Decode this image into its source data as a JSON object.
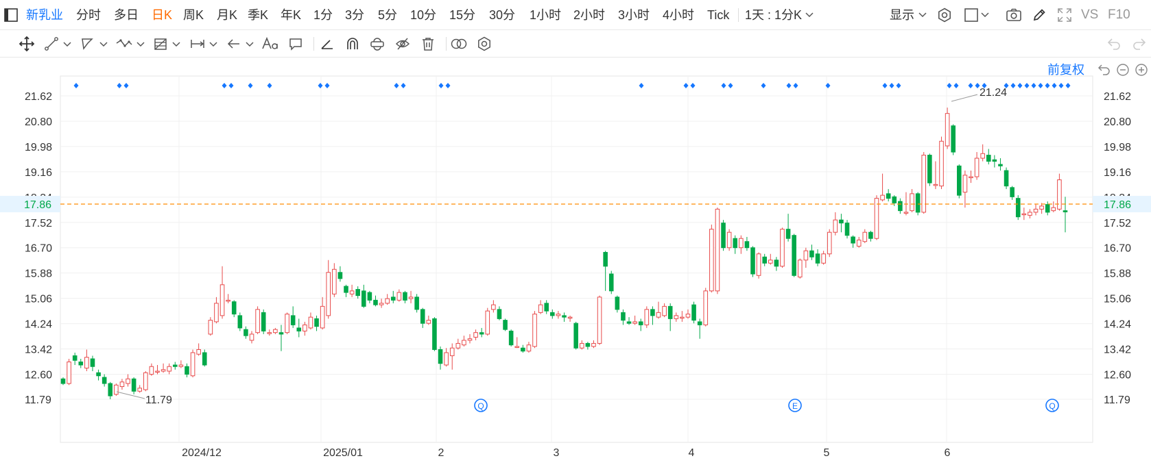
{
  "toolbar": {
    "stock_name": "新乳业",
    "periods": [
      "分时",
      "多日",
      "日K",
      "周K",
      "月K",
      "季K",
      "年K",
      "1分",
      "3分",
      "5分",
      "10分",
      "15分",
      "30分",
      "1小时",
      "2小时",
      "3小时",
      "4小时",
      "Tick"
    ],
    "active_period": "日K",
    "interval_select": "1天 : 1分K",
    "display_label": "显示",
    "vs_label": "VS",
    "f10_label": "F10"
  },
  "chart": {
    "adjust_label": "前复权",
    "current_price": "17.86",
    "high_label": "21.24",
    "low_label": "11.79",
    "y_ticks": [
      "21.62",
      "20.80",
      "19.98",
      "19.16",
      "18.34",
      "17.52",
      "16.70",
      "15.88",
      "15.06",
      "14.24",
      "13.42",
      "12.60",
      "11.79"
    ],
    "x_ticks": [
      "2024/12",
      "2025/01",
      "2",
      "3",
      "4",
      "5",
      "6"
    ],
    "event_markers": [
      "Q",
      "E",
      "Q"
    ],
    "colors": {
      "up": "#e84a4a",
      "down": "#00a849",
      "price_line": "#ff8c00",
      "accent": "#1677ff"
    }
  },
  "chart_data": {
    "type": "candlestick",
    "ylim": [
      11.4,
      22.0
    ],
    "last_price": 17.86,
    "high": 21.24,
    "low": 11.79,
    "x_ticks": [
      "2024/12",
      "2025/01",
      "2",
      "3",
      "4",
      "5",
      "6"
    ],
    "candles": [
      [
        12.45,
        12.3,
        12.5,
        12.25
      ],
      [
        12.3,
        13.0,
        13.1,
        12.25
      ],
      [
        13.2,
        13.05,
        13.3,
        12.9
      ],
      [
        13.0,
        12.9,
        13.1,
        12.8
      ],
      [
        12.8,
        13.15,
        13.4,
        12.7
      ],
      [
        13.1,
        12.85,
        13.2,
        12.7
      ],
      [
        12.65,
        12.55,
        12.75,
        12.4
      ],
      [
        12.5,
        12.3,
        12.6,
        12.2
      ],
      [
        12.3,
        11.9,
        12.35,
        11.79
      ],
      [
        11.95,
        12.25,
        12.3,
        11.9
      ],
      [
        12.2,
        12.35,
        12.45,
        12.1
      ],
      [
        12.3,
        12.45,
        12.6,
        12.2
      ],
      [
        12.45,
        12.05,
        12.5,
        11.95
      ],
      [
        12.05,
        12.15,
        12.25,
        12.0
      ],
      [
        12.1,
        12.65,
        12.7,
        12.05
      ],
      [
        12.6,
        12.85,
        12.95,
        12.55
      ],
      [
        12.7,
        12.7,
        12.9,
        12.6
      ],
      [
        12.7,
        12.75,
        12.95,
        12.65
      ],
      [
        12.7,
        12.85,
        12.95,
        12.6
      ],
      [
        12.9,
        12.85,
        13.0,
        12.75
      ],
      [
        12.85,
        12.9,
        13.05,
        12.8
      ],
      [
        12.85,
        12.6,
        12.95,
        12.5
      ],
      [
        12.55,
        13.3,
        13.4,
        12.5
      ],
      [
        13.25,
        13.4,
        13.6,
        13.2
      ],
      [
        13.3,
        12.9,
        13.4,
        12.85
      ],
      [
        13.9,
        14.35,
        14.45,
        13.85
      ],
      [
        14.3,
        14.9,
        15.1,
        14.25
      ],
      [
        14.5,
        15.5,
        16.1,
        14.4
      ],
      [
        15.0,
        15.0,
        15.2,
        14.9
      ],
      [
        14.95,
        14.55,
        15.0,
        14.45
      ],
      [
        14.5,
        14.1,
        14.6,
        14.0
      ],
      [
        14.05,
        13.85,
        14.15,
        13.75
      ],
      [
        13.7,
        13.9,
        14.0,
        13.6
      ],
      [
        13.95,
        14.7,
        14.8,
        13.9
      ],
      [
        14.6,
        14.0,
        14.7,
        13.9
      ],
      [
        13.95,
        13.95,
        14.05,
        13.85
      ],
      [
        13.95,
        14.05,
        14.1,
        13.9
      ],
      [
        13.95,
        13.9,
        14.2,
        13.35
      ],
      [
        13.95,
        14.55,
        14.6,
        13.9
      ],
      [
        14.5,
        14.2,
        14.8,
        14.1
      ],
      [
        14.1,
        14.0,
        14.4,
        13.8
      ],
      [
        14.0,
        14.2,
        14.3,
        13.85
      ],
      [
        14.1,
        14.45,
        14.6,
        14.05
      ],
      [
        14.4,
        14.15,
        14.5,
        14.0
      ],
      [
        14.1,
        14.8,
        15.1,
        14.05
      ],
      [
        14.5,
        15.9,
        16.3,
        14.4
      ],
      [
        15.2,
        16.0,
        16.2,
        15.1
      ],
      [
        15.9,
        15.7,
        16.1,
        15.6
      ],
      [
        15.45,
        15.25,
        15.5,
        15.1
      ],
      [
        15.2,
        15.3,
        15.5,
        15.1
      ],
      [
        15.35,
        15.15,
        15.45,
        15.05
      ],
      [
        15.3,
        14.8,
        15.5,
        14.75
      ],
      [
        15.25,
        15.0,
        15.3,
        14.9
      ],
      [
        15.0,
        14.85,
        15.15,
        14.8
      ],
      [
        14.85,
        14.9,
        15.05,
        14.75
      ],
      [
        14.9,
        15.05,
        15.2,
        14.85
      ],
      [
        15.1,
        15.0,
        15.3,
        14.9
      ],
      [
        15.0,
        15.25,
        15.35,
        14.95
      ],
      [
        15.25,
        15.0,
        15.3,
        14.9
      ],
      [
        15.05,
        15.1,
        15.3,
        14.9
      ],
      [
        15.1,
        14.7,
        15.2,
        14.6
      ],
      [
        14.7,
        14.25,
        14.75,
        14.1
      ],
      [
        14.25,
        14.35,
        14.5,
        14.2
      ],
      [
        14.4,
        13.4,
        14.45,
        13.35
      ],
      [
        13.4,
        12.95,
        13.5,
        12.75
      ],
      [
        12.9,
        13.3,
        13.45,
        12.85
      ],
      [
        13.2,
        13.45,
        13.6,
        12.75
      ],
      [
        13.45,
        13.6,
        13.75,
        13.4
      ],
      [
        13.55,
        13.7,
        13.85,
        13.5
      ],
      [
        13.7,
        13.75,
        13.9,
        13.6
      ],
      [
        13.8,
        13.95,
        14.05,
        13.7
      ],
      [
        13.95,
        13.9,
        14.1,
        13.8
      ],
      [
        13.9,
        14.65,
        14.75,
        13.85
      ],
      [
        14.7,
        14.85,
        15.0,
        14.6
      ],
      [
        14.7,
        14.4,
        14.8,
        14.35
      ],
      [
        14.35,
        14.05,
        14.4,
        14.0
      ],
      [
        14.0,
        13.55,
        14.05,
        13.5
      ],
      [
        13.5,
        13.5,
        13.8,
        13.45
      ],
      [
        13.45,
        13.35,
        13.55,
        13.3
      ],
      [
        13.35,
        13.55,
        13.65,
        13.3
      ],
      [
        13.5,
        14.55,
        14.65,
        13.45
      ],
      [
        14.6,
        14.85,
        15.0,
        14.55
      ],
      [
        14.9,
        14.65,
        15.0,
        14.55
      ],
      [
        14.6,
        14.5,
        14.7,
        14.4
      ],
      [
        14.5,
        14.55,
        14.65,
        14.4
      ],
      [
        14.5,
        14.45,
        14.6,
        14.3
      ],
      [
        14.45,
        14.45,
        14.5,
        14.3
      ],
      [
        14.25,
        13.45,
        14.3,
        13.4
      ],
      [
        13.45,
        13.6,
        13.7,
        13.4
      ],
      [
        13.6,
        13.5,
        13.65,
        13.4
      ],
      [
        13.5,
        13.6,
        13.7,
        13.45
      ],
      [
        13.6,
        15.1,
        15.15,
        13.55
      ],
      [
        16.55,
        16.1,
        16.6,
        15.3
      ],
      [
        15.85,
        15.3,
        15.95,
        15.2
      ],
      [
        15.1,
        14.7,
        15.15,
        14.6
      ],
      [
        14.6,
        14.35,
        14.7,
        14.2
      ],
      [
        14.3,
        14.25,
        14.45,
        14.2
      ],
      [
        14.25,
        14.3,
        14.5,
        14.2
      ],
      [
        14.3,
        14.2,
        14.4,
        14.0
      ],
      [
        14.2,
        14.7,
        14.8,
        14.1
      ],
      [
        14.7,
        14.5,
        14.8,
        14.2
      ],
      [
        14.45,
        14.6,
        14.95,
        14.4
      ],
      [
        14.5,
        14.8,
        14.9,
        14.45
      ],
      [
        14.8,
        14.4,
        14.9,
        14.0
      ],
      [
        14.4,
        14.5,
        14.6,
        14.3
      ],
      [
        14.45,
        14.45,
        14.65,
        14.3
      ],
      [
        14.45,
        14.55,
        14.7,
        14.4
      ],
      [
        14.85,
        14.35,
        14.95,
        14.25
      ],
      [
        14.3,
        14.2,
        14.4,
        13.75
      ],
      [
        14.2,
        15.3,
        15.4,
        14.15
      ],
      [
        15.3,
        17.3,
        17.45,
        15.25
      ],
      [
        15.3,
        17.95,
        18.0,
        15.2
      ],
      [
        17.5,
        16.7,
        17.6,
        16.6
      ],
      [
        16.7,
        17.2,
        17.3,
        16.6
      ],
      [
        17.0,
        16.7,
        17.1,
        16.5
      ],
      [
        16.7,
        17.0,
        17.1,
        16.5
      ],
      [
        16.9,
        16.7,
        17.05,
        16.6
      ],
      [
        16.7,
        15.85,
        16.75,
        15.75
      ],
      [
        15.8,
        16.5,
        16.55,
        15.7
      ],
      [
        16.4,
        16.2,
        16.5,
        16.1
      ],
      [
        16.2,
        16.3,
        16.5,
        16.15
      ],
      [
        16.3,
        16.1,
        16.4,
        15.95
      ],
      [
        16.1,
        17.3,
        17.35,
        16.05
      ],
      [
        17.3,
        17.0,
        17.8,
        16.9
      ],
      [
        17.1,
        15.8,
        17.15,
        15.75
      ],
      [
        15.75,
        16.3,
        16.35,
        15.7
      ],
      [
        16.3,
        16.6,
        16.7,
        16.05
      ],
      [
        16.6,
        16.4,
        16.8,
        16.3
      ],
      [
        16.5,
        16.2,
        16.65,
        16.1
      ],
      [
        16.2,
        16.5,
        16.6,
        16.15
      ],
      [
        16.5,
        17.2,
        17.3,
        16.4
      ],
      [
        17.2,
        17.6,
        17.85,
        17.1
      ],
      [
        17.6,
        17.5,
        17.8,
        17.2
      ],
      [
        17.5,
        17.1,
        17.6,
        17.0
      ],
      [
        17.05,
        16.85,
        17.1,
        16.7
      ],
      [
        16.75,
        16.95,
        17.05,
        16.7
      ],
      [
        16.9,
        17.2,
        17.3,
        16.85
      ],
      [
        17.2,
        17.0,
        17.25,
        16.9
      ],
      [
        17.0,
        18.3,
        18.4,
        16.95
      ],
      [
        18.25,
        18.4,
        19.1,
        18.2
      ],
      [
        18.45,
        18.3,
        18.6,
        18.2
      ],
      [
        18.35,
        18.15,
        18.4,
        18.05
      ],
      [
        18.2,
        17.9,
        18.3,
        17.8
      ],
      [
        17.85,
        17.85,
        18.5,
        17.75
      ],
      [
        17.9,
        18.45,
        18.6,
        17.85
      ],
      [
        18.45,
        17.85,
        18.5,
        17.75
      ],
      [
        17.85,
        19.7,
        19.8,
        17.8
      ],
      [
        19.7,
        18.8,
        19.75,
        18.7
      ],
      [
        18.75,
        18.75,
        19.5,
        18.6
      ],
      [
        18.7,
        20.15,
        20.3,
        18.6
      ],
      [
        20.0,
        21.05,
        21.24,
        19.9
      ],
      [
        20.65,
        19.8,
        20.7,
        19.7
      ],
      [
        19.35,
        18.4,
        19.4,
        18.3
      ],
      [
        18.5,
        19.05,
        19.2,
        18.0
      ],
      [
        19.0,
        19.0,
        19.2,
        18.8
      ],
      [
        19.0,
        19.6,
        19.8,
        18.9
      ],
      [
        19.6,
        19.75,
        20.05,
        19.5
      ],
      [
        19.7,
        19.5,
        19.9,
        19.4
      ],
      [
        19.55,
        19.5,
        19.7,
        19.3
      ],
      [
        19.4,
        19.35,
        19.6,
        19.2
      ],
      [
        19.2,
        18.7,
        19.3,
        18.6
      ],
      [
        18.65,
        18.35,
        18.7,
        18.25
      ],
      [
        18.3,
        17.7,
        18.4,
        17.6
      ],
      [
        17.8,
        17.8,
        18.0,
        17.6
      ],
      [
        17.75,
        17.85,
        17.95,
        17.65
      ],
      [
        17.85,
        17.95,
        18.1,
        17.75
      ],
      [
        17.95,
        18.05,
        18.15,
        17.8
      ],
      [
        18.1,
        17.85,
        18.2,
        17.75
      ],
      [
        17.9,
        18.0,
        18.2,
        17.85
      ],
      [
        17.95,
        18.9,
        19.1,
        17.9
      ],
      [
        17.9,
        17.86,
        18.35,
        17.2
      ]
    ]
  }
}
